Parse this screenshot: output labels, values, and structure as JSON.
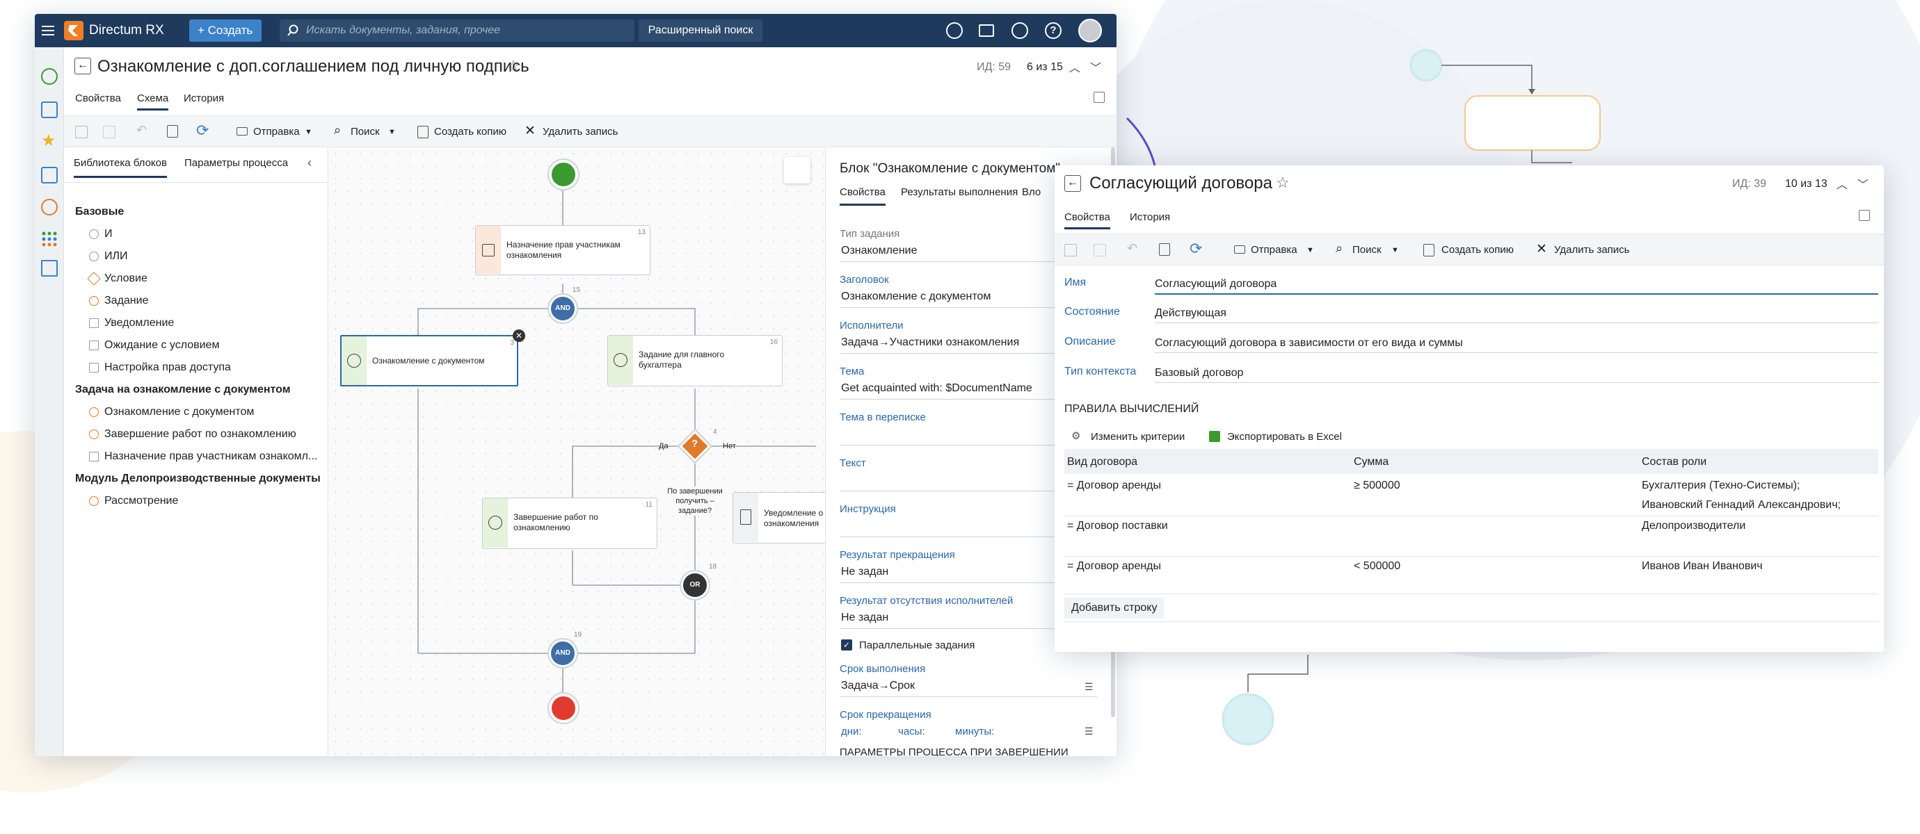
{
  "app": {
    "title": "Directum RX",
    "create_label": "+ Создать",
    "search_placeholder": "Искать документы, задания, прочее",
    "advanced_search": "Расширенный поиск"
  },
  "doc": {
    "title": "Ознакомление с доп.соглашением под личную подпись",
    "id": "ИД: 59",
    "counter": "6 из 15",
    "tabs": [
      "Свойства",
      "Схема",
      "История"
    ]
  },
  "toolbar": {
    "send": "Отправка",
    "search": "Поиск",
    "copy": "Создать копию",
    "delete": "Удалить запись"
  },
  "library": {
    "tabs": [
      "Библиотека блоков",
      "Параметры процесса"
    ],
    "groups": [
      {
        "title": "Базовые",
        "items": [
          "И",
          "ИЛИ",
          "Условие",
          "Задание",
          "Уведомление",
          "Ожидание с условием",
          "Настройка прав доступа"
        ]
      },
      {
        "title": "Задача на ознакомление с документом",
        "items": [
          "Ознакомление с документом",
          "Завершение работ по ознакомлению",
          "Назначение прав участникам ознакомл..."
        ]
      },
      {
        "title": "Модуль Делопроизводственные документы",
        "items": [
          "Рассмотрение"
        ]
      }
    ]
  },
  "diagram": {
    "n13": "Назначение прав участникам ознакомления",
    "n13_num": "13",
    "n15": "AND",
    "n15_num": "15",
    "n3": "Ознакомление с документом",
    "n3_num": "3",
    "n16": "Задание для главного бухгалтера",
    "n16_num": "16",
    "n4_q": "По завершении получить – задание?",
    "n4_num": "4",
    "yes": "Да",
    "no": "Нет",
    "n11": "Завершение работ по ознакомлению",
    "n11_num": "11",
    "n_notify": "Уведомление о ознакомления",
    "n18": "OR",
    "n18_num": "18",
    "n19": "AND",
    "n19_num": "19"
  },
  "block": {
    "title": "Блок \"Ознакомление с документом\"",
    "tabs": [
      "Свойства",
      "Результаты выполнения",
      "Вло"
    ],
    "fields": [
      {
        "label": "Тип задания",
        "value": "Ознакомление",
        "muted": true
      },
      {
        "label": "Заголовок",
        "value": "Ознакомление с документом"
      },
      {
        "label": "Исполнители",
        "value": "Задача→Участники ознакомления"
      },
      {
        "label": "Тема",
        "value": "Get acquainted with: $DocumentName"
      },
      {
        "label": "Тема в переписке",
        "value": ""
      },
      {
        "label": "Текст",
        "value": ""
      },
      {
        "label": "Инструкция",
        "value": ""
      },
      {
        "label": "Результат прекращения",
        "value": "Не задан"
      },
      {
        "label": "Результат отсутствия исполнителей",
        "value": "Не задан"
      }
    ],
    "parallel": "Параллельные задания",
    "deadline_label": "Срок выполнения",
    "deadline_value": "Задача→Срок",
    "stop_label": "Срок прекращения",
    "days": "дни:",
    "hours": "часы:",
    "minutes": "минуты:",
    "params_header": "ПАРАМЕТРЫ ПРОЦЕССА ПРИ ЗАВЕРШЕНИИ"
  },
  "rule": {
    "title": "Согласующий договора",
    "id": "ИД: 39",
    "counter": "10 из 13",
    "tabs": [
      "Свойства",
      "История"
    ],
    "fields": [
      {
        "label": "Имя",
        "value": "Согласующий договора"
      },
      {
        "label": "Состояние",
        "value": "Действующая"
      },
      {
        "label": "Описание",
        "value": "Согласующий договора в зависимости от его вида и суммы"
      },
      {
        "label": "Тип контекста",
        "value": "Базовый договор"
      }
    ],
    "section": "ПРАВИЛА ВЫЧИСЛЕНИЙ",
    "change_criteria": "Изменить критерии",
    "export": "Экспортировать в Excel",
    "columns": [
      "Вид договора",
      "Сумма",
      "Состав роли"
    ],
    "rows": [
      {
        "type": "= Договор аренды",
        "sum": "≥ 500000",
        "role": "Бухгалтерия (Техно-Системы);",
        "role2": "Ивановский Геннадий Александрович;"
      },
      {
        "type": "= Договор поставки",
        "sum": "",
        "role": "Делопроизводители",
        "role2": ""
      },
      {
        "type": "= Договор аренды",
        "sum": "< 500000",
        "role": "Иванов Иван Иванович",
        "role2": ""
      }
    ],
    "add_row": "Добавить строку"
  },
  "colors": {
    "topbar": "#1e3a5c",
    "accent": "#3b82c9",
    "start": "#3a9a2f",
    "end": "#e03b2e",
    "and": "#3f6ea6",
    "orange": "#e07a2c"
  }
}
